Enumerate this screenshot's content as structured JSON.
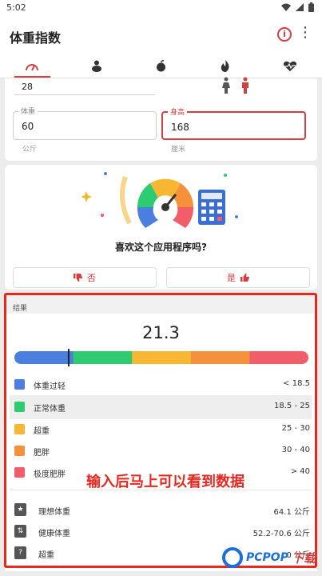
{
  "status_bar": {
    "time": "5:02"
  },
  "app_bar": {
    "title": "体重指数",
    "info_glyph": "i",
    "more_glyph": "⋮"
  },
  "tabs": [
    {
      "icon": "gauge-icon",
      "active": true
    },
    {
      "icon": "person-icon",
      "active": false
    },
    {
      "icon": "apple-icon",
      "active": false
    },
    {
      "icon": "flame-icon",
      "active": false
    },
    {
      "icon": "heartbeat-icon",
      "active": false
    }
  ],
  "inputs": {
    "age": {
      "value": "28"
    },
    "weight": {
      "label": "体重",
      "value": "60",
      "unit": "公斤"
    },
    "height": {
      "label": "身高",
      "value": "168",
      "unit": "厘米"
    }
  },
  "gender_icons": [
    "female-icon",
    "male-icon"
  ],
  "rating": {
    "question": "喜欢这个应用程序吗?",
    "no_label": "否",
    "yes_label": "是"
  },
  "result": {
    "section_label": "结果",
    "bmi": "21.3",
    "bmi_value": 21.3,
    "scale_min": 16.5,
    "scale_max": 42.5,
    "scale_colors": [
      "#4a7fe0",
      "#2ecc71",
      "#f7b733",
      "#f4913a",
      "#f25d6a"
    ],
    "categories": [
      {
        "name": "体重过轻",
        "range": "< 18.5",
        "color": "#4a7fe0",
        "highlight": false
      },
      {
        "name": "正常体重",
        "range": "18.5 - 25",
        "color": "#2ecc71",
        "highlight": true
      },
      {
        "name": "超重",
        "range": "25 - 30",
        "color": "#f7b733",
        "highlight": false
      },
      {
        "name": "肥胖",
        "range": "30 - 40",
        "color": "#f4913a",
        "highlight": false
      },
      {
        "name": "极度肥胖",
        "range": "> 40",
        "color": "#f25d6a",
        "highlight": false
      }
    ],
    "stats": [
      {
        "name": "理想体重",
        "value": "64.1 公斤",
        "icon": "ideal-weight-icon"
      },
      {
        "name": "健康体重",
        "value": "52.2-70.6 公斤",
        "icon": "healthy-weight-icon"
      },
      {
        "name": "超重",
        "value": "0 公斤",
        "icon": "overweight-icon"
      }
    ]
  },
  "annotation": {
    "caption": "输入后马上可以看到数据"
  },
  "watermark": {
    "brand": "PCPOP",
    "suffix": "下载"
  },
  "colors": {
    "accent": "#d43f3f",
    "annotation_red": "#e8271f"
  }
}
